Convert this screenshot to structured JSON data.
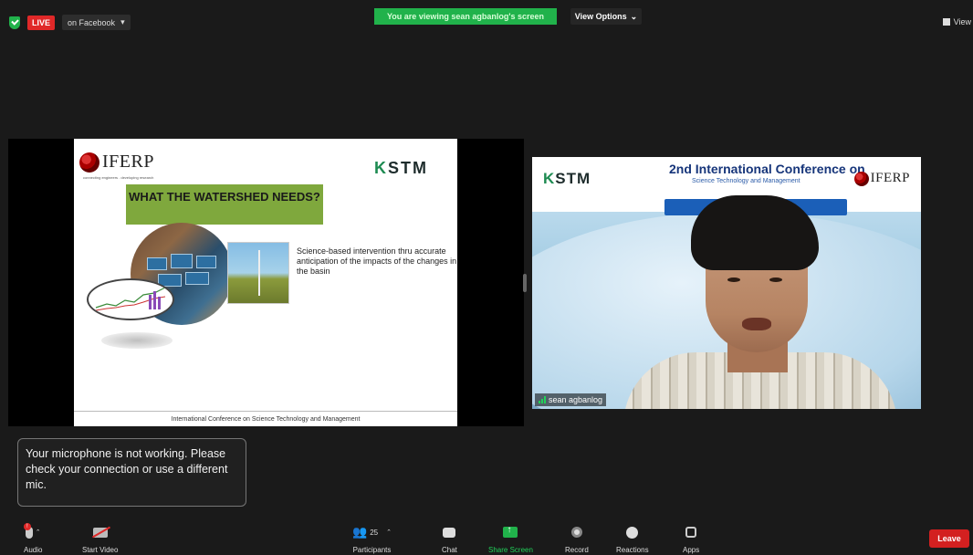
{
  "top_bar": {
    "live_label": "LIVE",
    "live_platform": "on Facebook",
    "sharing_banner": "You are viewing sean agbanlog's screen",
    "view_options_label": "View Options",
    "view_label": "View"
  },
  "shared_slide": {
    "iferp_logo_text": "IFERP",
    "iferp_tagline": "connecting engineers . developing research",
    "kstm_logo_text": "STM",
    "kstm_logo_k": "K",
    "title": "WHAT THE WATERSHED NEEDS?",
    "body": "Science-based intervention thru accurate anticipation of the impacts of the changes in the basin",
    "footer": "International Conference on Science Technology and Management"
  },
  "speaker_video": {
    "kstm_logo_k": "K",
    "kstm_logo_text": "STM",
    "conference_title": "2nd International Conference on",
    "conference_subtitle": "Science Technology and Management",
    "iferp_logo_text": "IFERP",
    "participant_name": "sean agbanlog"
  },
  "toast": {
    "message": "Your microphone is not working. Please check your connection or use a different mic."
  },
  "toolbar": {
    "audio_label": "Audio",
    "start_video_label": "Start Video",
    "participants_label": "Participants",
    "participants_count": "25",
    "chat_label": "Chat",
    "share_screen_label": "Share Screen",
    "record_label": "Record",
    "reactions_label": "Reactions",
    "apps_label": "Apps",
    "leave_label": "Leave"
  },
  "colors": {
    "zoom_green": "#21b24b",
    "live_red": "#e02828",
    "leave_red": "#d32020",
    "background": "#1a1a1a"
  }
}
